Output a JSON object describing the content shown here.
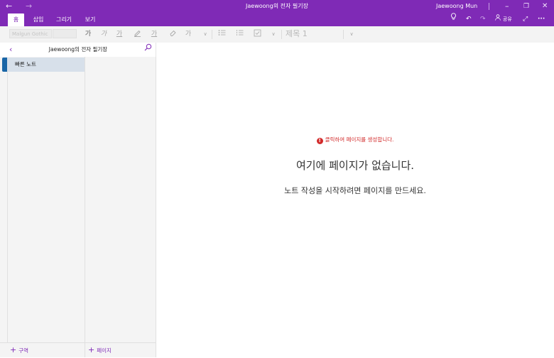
{
  "titlebar": {
    "back_icon": "arrow-left-icon",
    "forward_icon": "arrow-right-icon",
    "title": "Jaewoong의 전자 필기장",
    "user_name": "Jaewoong Mun",
    "minimize_icon": "minimize-icon",
    "restore_icon": "restore-icon",
    "close_icon": "close-icon",
    "background_color": "#7f2ab6"
  },
  "tabs": [
    {
      "label": "홈",
      "active": true
    },
    {
      "label": "삽입",
      "active": false
    },
    {
      "label": "그리기",
      "active": false
    },
    {
      "label": "보기",
      "active": false
    }
  ],
  "tabbar_right": {
    "tell_me_icon": "lightbulb-icon",
    "undo_icon": "undo-icon",
    "redo_icon": "redo-icon",
    "share_label": "공유",
    "fullscreen_icon": "expand-icon",
    "more_icon": "more-icon"
  },
  "ribbon": {
    "font_name": "Malgun Gothic",
    "font_size": "",
    "bold_glyph": "가",
    "italic_glyph": "가",
    "underline_glyph": "가",
    "highlight_icon": "highlighter-icon",
    "font_color_glyph": "가",
    "clear_format_icon": "eraser-icon",
    "spell_glyph": "가",
    "bullets_icon": "bullet-list-icon",
    "numbering_icon": "numbered-list-icon",
    "todo_icon": "checkbox-icon",
    "style_label": "제목 1"
  },
  "notebook": {
    "name": "Jaewoong의 전자 필기장",
    "back_icon": "chevron-left-icon",
    "search_icon": "search-icon"
  },
  "sections": [
    {
      "label": "빠른 노트",
      "color": "#1a66a7",
      "selected": true
    }
  ],
  "footer": {
    "add_section": "구역",
    "add_page": "페이지"
  },
  "canvas": {
    "hint": "클릭하여 페이지를 생성합니다.",
    "hint_color": "#d22b2b",
    "empty_title": "여기에 페이지가 없습니다.",
    "empty_subtitle": "노트 작성을 시작하려면 페이지를 만드세요."
  }
}
